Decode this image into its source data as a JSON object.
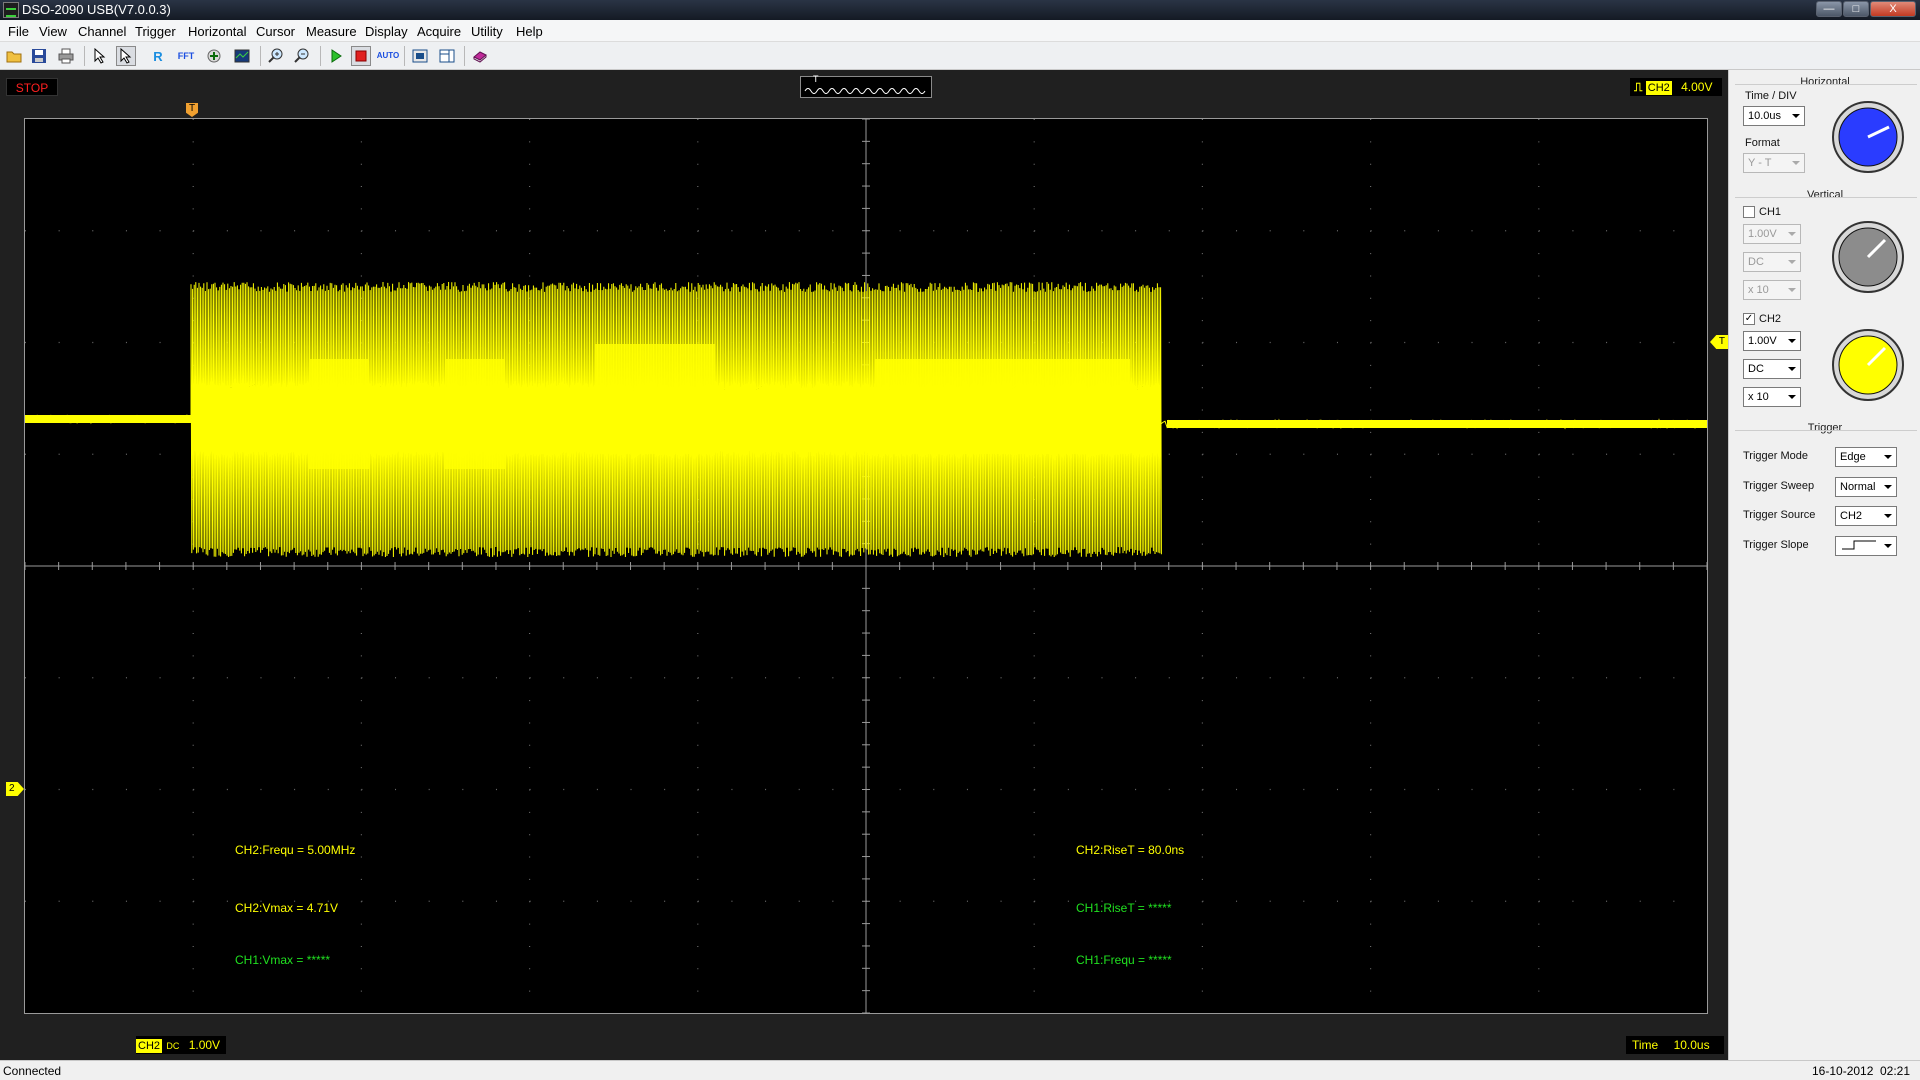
{
  "window": {
    "title": "DSO-2090 USB(V7.0.0.3)",
    "minimize": "—",
    "maximize": "□",
    "close": "X"
  },
  "menu": [
    "File",
    "View",
    "Channel",
    "Trigger",
    "Horizontal",
    "Cursor",
    "Measure",
    "Display",
    "Acquire",
    "Utility",
    "Help"
  ],
  "toolbar": {
    "icons": [
      "open-folder-icon",
      "save-icon",
      "print-icon",
      "pointer-icon",
      "cursor-select-icon",
      "ref-icon",
      "fft-icon",
      "math-icon",
      "zoom-screen-icon",
      "zoom-in-icon",
      "zoom-out-icon",
      "run-icon",
      "stop-icon",
      "auto-icon",
      "capture-icon",
      "layout-icon",
      "record-icon"
    ],
    "ref_glyph": "R",
    "fft_glyph": "FFT",
    "auto_glyph": "AUTO"
  },
  "scope": {
    "status": "STOP",
    "trigger_overview_marker": "T",
    "trigger_level": "4.00V",
    "trigger_channel_tag": "CH2",
    "ch2_marker": "2",
    "trigger_level_marker": "T",
    "trigger_position_marker": "T",
    "bottom_channel_tag": "CH2",
    "bottom_coupling": "DC",
    "bottom_volts": "1.00V",
    "time_label": "Time",
    "time_value": "10.0us",
    "trace_color": "#ffff00",
    "measurements": {
      "m1": "CH2:Frequ = 5.00MHz",
      "m2": "CH2:Vmax = 4.71V",
      "m3": "CH1:Vmax = *****",
      "m4": "CH2:RiseT = 80.0ns",
      "m5": "CH1:RiseT = *****",
      "m6": "CH1:Frequ = *****"
    }
  },
  "panel": {
    "horizontal": {
      "title": "Horizontal",
      "time_div_label": "Time / DIV",
      "time_div_value": "10.0us",
      "format_label": "Format",
      "format_value": "Y - T",
      "knob_color": "#2a3cff"
    },
    "vertical": {
      "title": "Vertical",
      "ch1": {
        "label": "CH1",
        "checked": false,
        "volts": "1.00V",
        "coupling": "DC",
        "probe": "x 10",
        "knob_color": "#8c8c8c"
      },
      "ch2": {
        "label": "CH2",
        "checked": true,
        "check_glyph": "✓",
        "volts": "1.00V",
        "coupling": "DC",
        "probe": "x 10",
        "knob_color": "#ffff00"
      }
    },
    "trigger": {
      "title": "Trigger",
      "mode_label": "Trigger Mode",
      "mode_value": "Edge",
      "sweep_label": "Trigger Sweep",
      "sweep_value": "Normal",
      "source_label": "Trigger Source",
      "source_value": "CH2",
      "slope_label": "Trigger Slope",
      "slope_value": ""
    }
  },
  "status": {
    "text": "Connected",
    "date": "16-10-2012",
    "time": "02:21"
  }
}
